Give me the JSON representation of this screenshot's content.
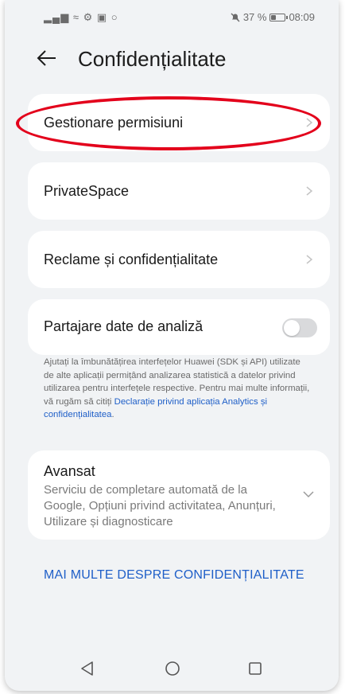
{
  "status_bar": {
    "left_icons": "▂▄▆ ≈ ⚙ ▣ ○",
    "mute_icon": "🔕",
    "battery_text": "37 %",
    "battery_level": 0.37,
    "time": "08:09"
  },
  "header": {
    "title": "Confidențialitate"
  },
  "items": {
    "permissions": "Gestionare permisiuni",
    "private_space": "PrivateSpace",
    "ads": "Reclame și confidențialitate",
    "analytics_share": "Partajare date de analiză"
  },
  "analytics_toggle_on": false,
  "description": {
    "text": "Ajutați la îmbunătățirea interfețelor Huawei (SDK și API) utilizate de alte aplicații permițând analizarea statistică a datelor privind utilizarea pentru interfețele respective. Pentru mai multe informații, vă rugăm să citiți ",
    "link": "Declarație privind aplicația Analytics și confidențialitatea",
    "end": "."
  },
  "advanced": {
    "title": "Avansat",
    "subtitle": "Serviciu de completare automată de la Google, Opțiuni privind activitatea, Anunțuri, Utilizare și diagnosticare"
  },
  "more_link": "MAI MULTE DESPRE CONFIDENȚIALITATE",
  "colors": {
    "accent": "#1f5fc8",
    "highlight": "#e3001b",
    "background": "#f1f3f5"
  }
}
